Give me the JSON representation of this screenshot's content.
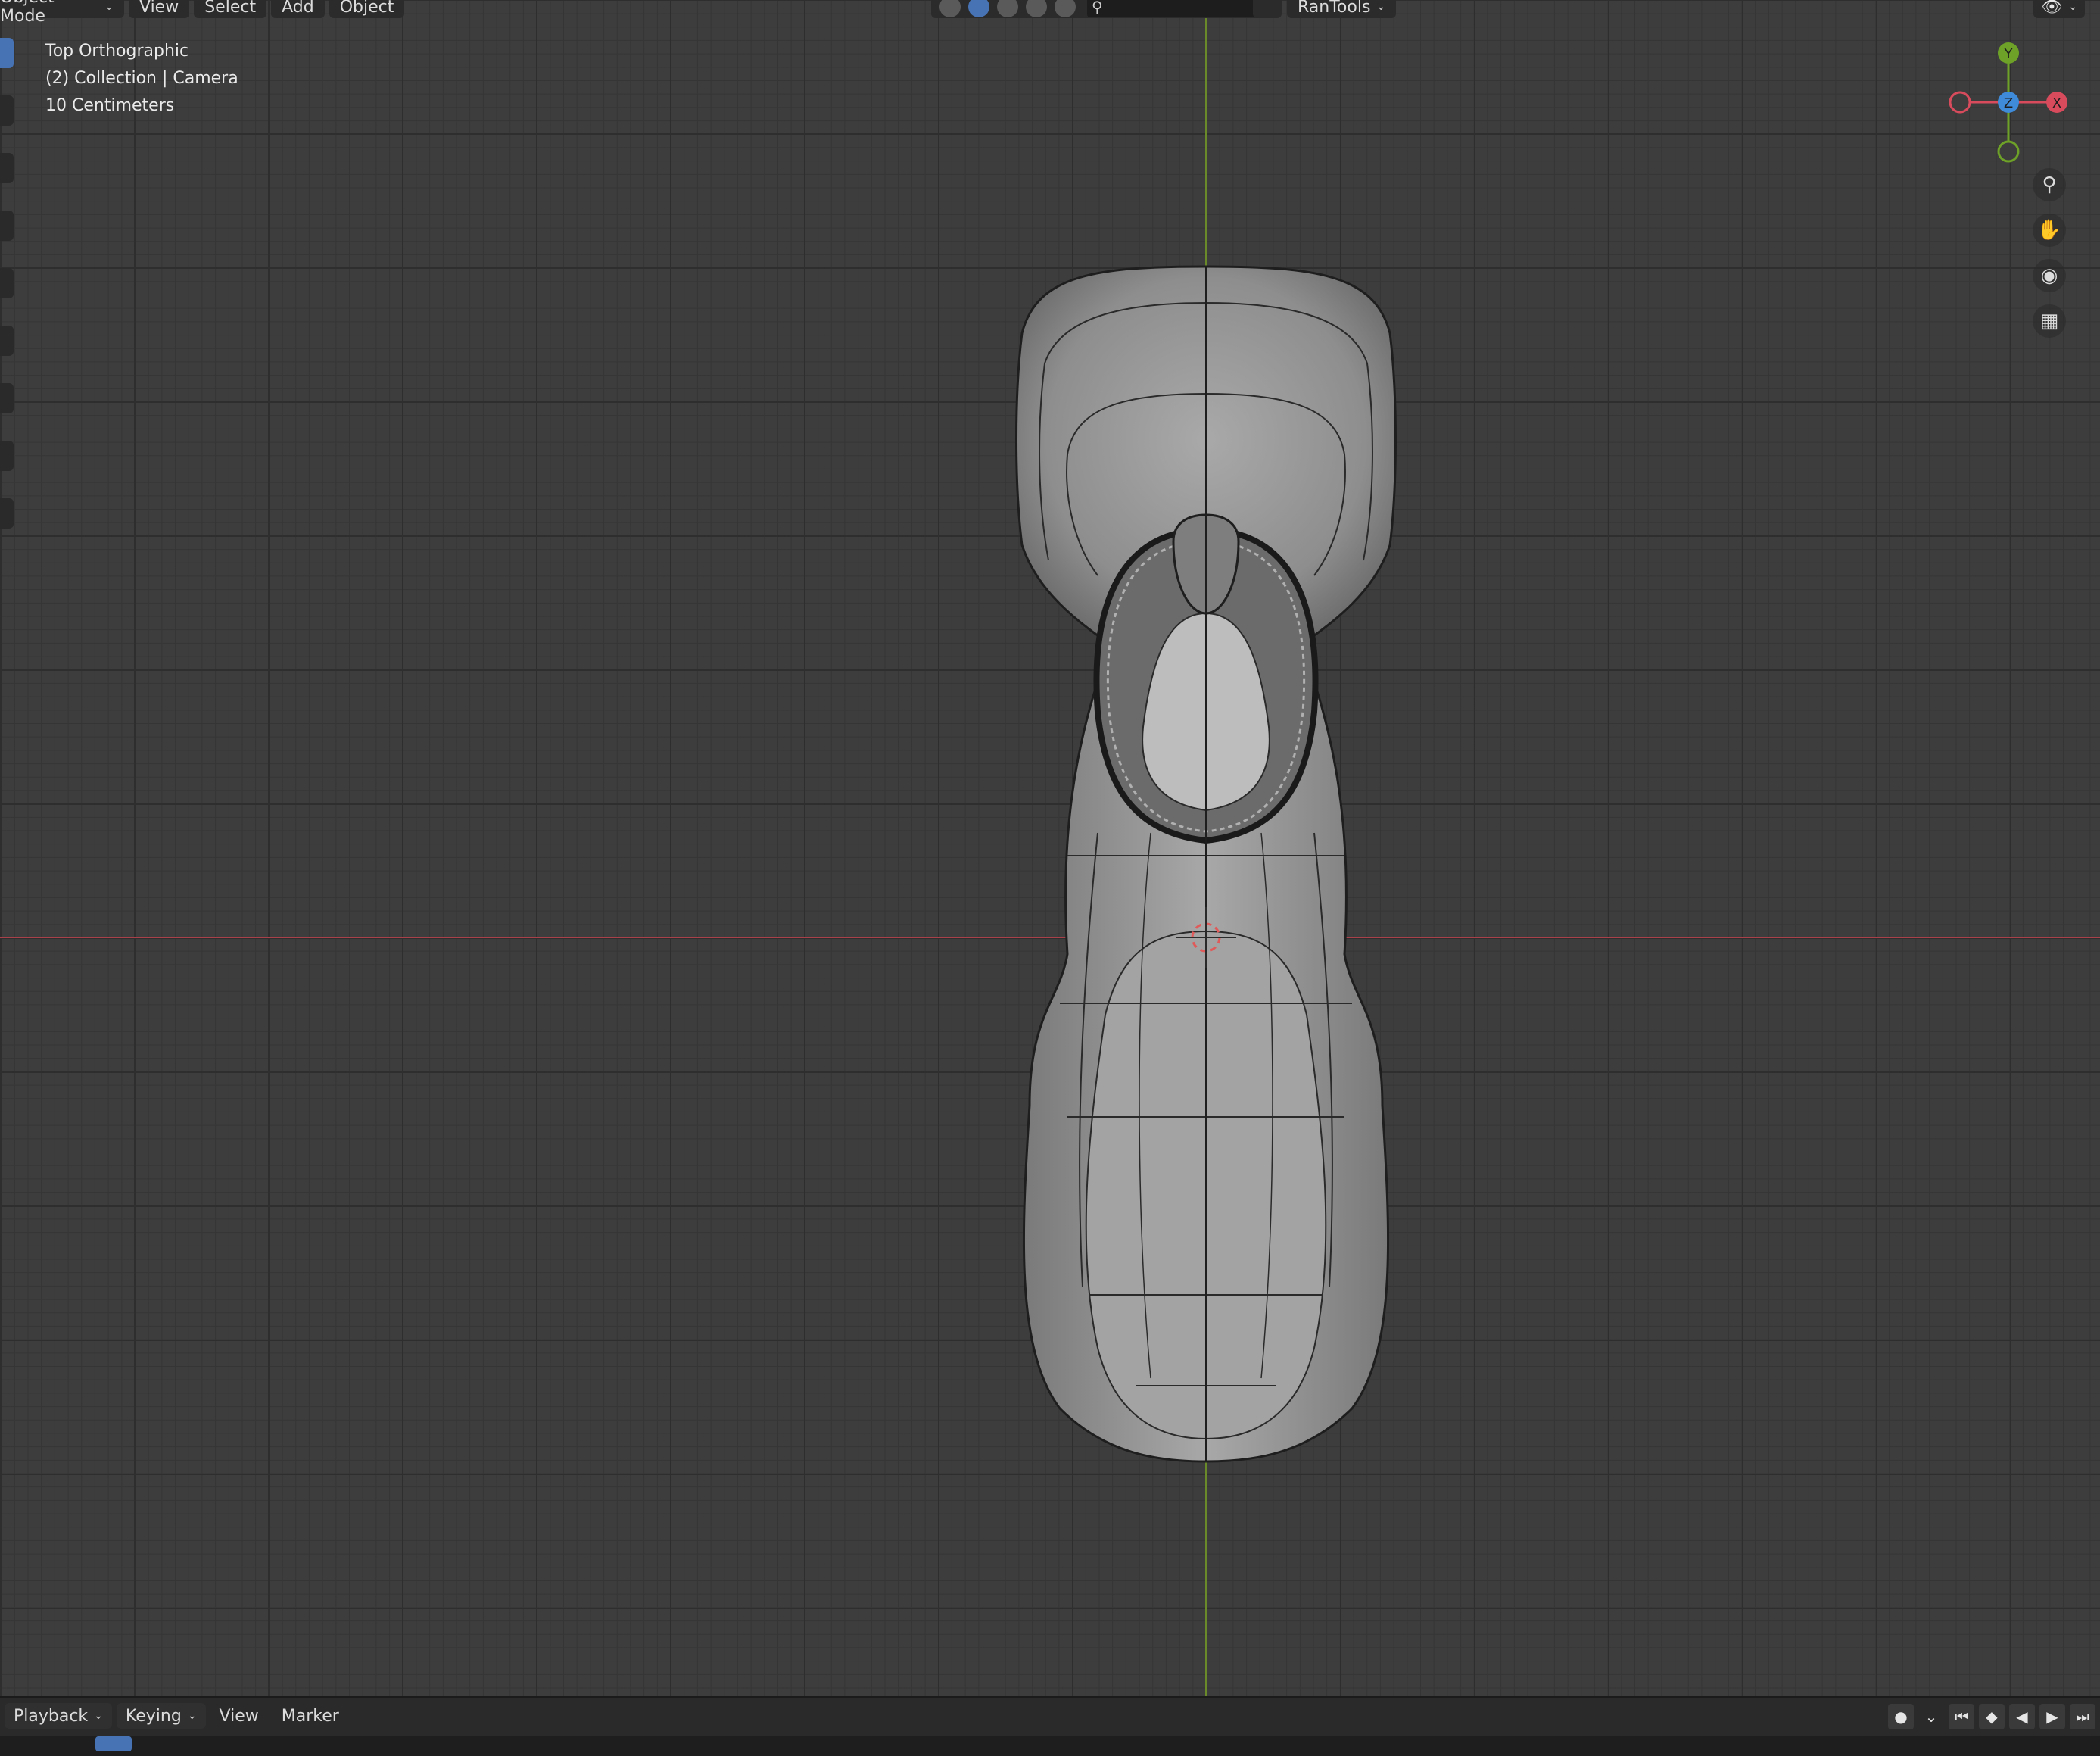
{
  "header": {
    "mode": "Object Mode",
    "menus": [
      "View",
      "Select",
      "Add",
      "Object"
    ],
    "addon": "RanTools"
  },
  "viewport_info": {
    "view": "Top Orthographic",
    "collection": "(2) Collection | Camera",
    "scale": "10 Centimeters"
  },
  "gizmo": {
    "y": "Y",
    "z": "Z",
    "x": "X"
  },
  "colors": {
    "x_axis": "#d84b5d",
    "y_axis": "#6da127",
    "z_axis": "#3f8bd9",
    "active": "#4772b3"
  },
  "timeline": {
    "menus": [
      "Playback",
      "Keying",
      "View",
      "Marker"
    ]
  }
}
